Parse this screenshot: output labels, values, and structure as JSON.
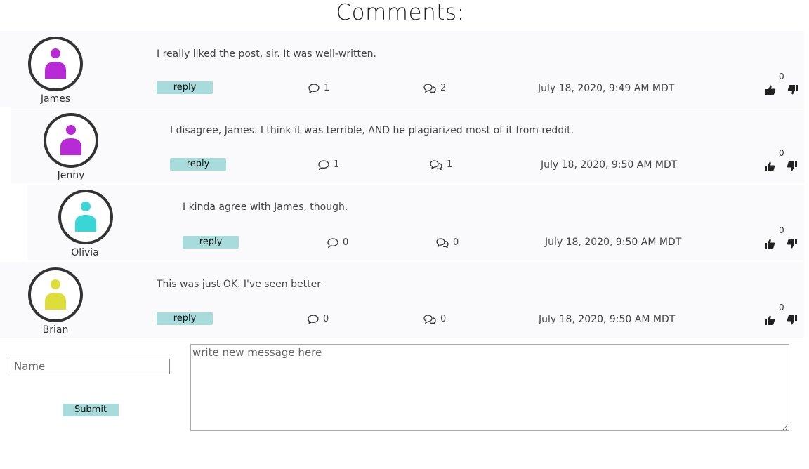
{
  "page": {
    "title": "Comments:"
  },
  "colors": {
    "reply_button": "#a8dcdc",
    "avatar_border": "#333333"
  },
  "comments": [
    {
      "author": "James",
      "avatar_color": "#b82ad6",
      "text": "I really liked the post, sir. It was well-written.",
      "reply_label": "reply",
      "comments_count": "1",
      "replies_count": "2",
      "date": "July 18, 2020, 9:49 AM MDT",
      "votes": "0"
    },
    {
      "author": "Jenny",
      "avatar_color": "#b82ad6",
      "text": "I disagree, James. I think it was terrible, AND he plagiarized most of it from reddit.",
      "reply_label": "reply",
      "comments_count": "1",
      "replies_count": "1",
      "date": "July 18, 2020, 9:50 AM MDT",
      "votes": "0"
    },
    {
      "author": "Olivia",
      "avatar_color": "#3ad6d6",
      "text": "I kinda agree with James, though.",
      "reply_label": "reply",
      "comments_count": "0",
      "replies_count": "0",
      "date": "July 18, 2020, 9:50 AM MDT",
      "votes": "0"
    },
    {
      "author": "Brian",
      "avatar_color": "#dede3a",
      "text": "This was just OK. I've seen better",
      "reply_label": "reply",
      "comments_count": "0",
      "replies_count": "0",
      "date": "July 18, 2020, 9:50 AM MDT",
      "votes": "0"
    }
  ],
  "form": {
    "name_placeholder": "Name",
    "name_value": "",
    "message_placeholder": "write new message here",
    "message_value": "",
    "submit_label": "Submit"
  },
  "icons": {
    "comment": "speech-bubble-icon",
    "replies": "double-speech-bubble-icon",
    "upvote": "thumbs-up-icon",
    "downvote": "thumbs-down-icon"
  }
}
